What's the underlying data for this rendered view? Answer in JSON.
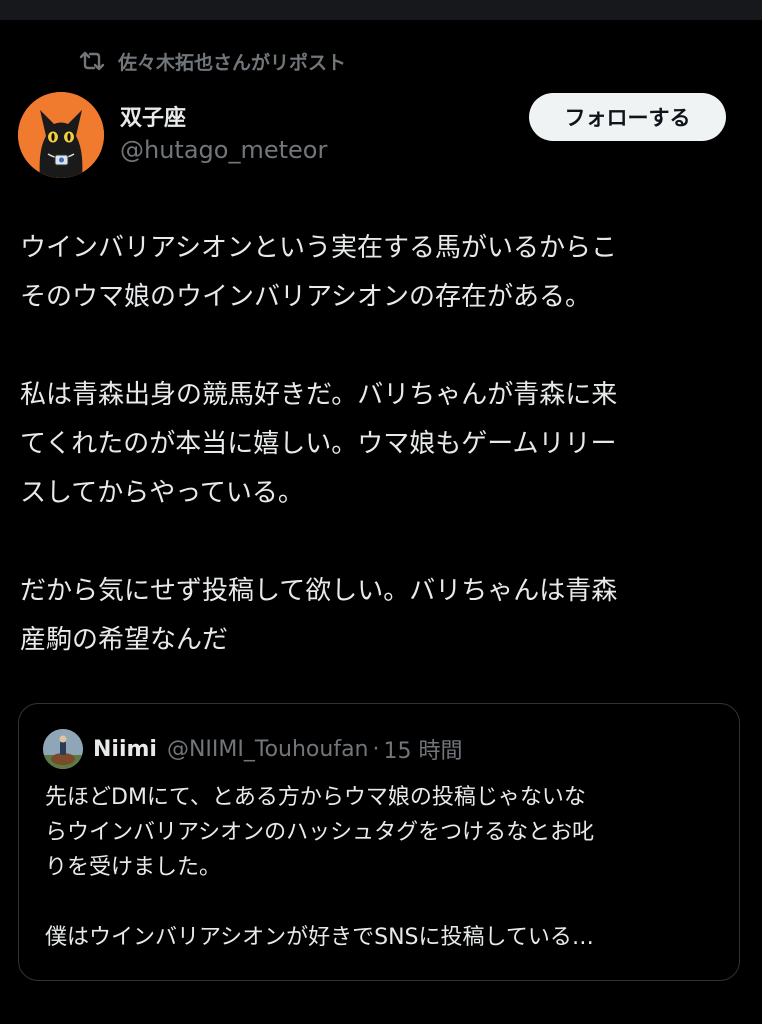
{
  "repost": {
    "icon": "repost-icon",
    "label": "佐々木拓也さんがリポスト"
  },
  "author": {
    "display_name": "双子座",
    "handle": "@hutago_meteor",
    "avatar_icon": "black-cat-avatar",
    "avatar_bg": "#f07a2e"
  },
  "follow_button": {
    "label": "フォローする"
  },
  "tweet": {
    "paragraph_1": "ウインバリアシオンという実在する馬がいるからこ\nそのウマ娘のウインバリアシオンの存在がある。",
    "paragraph_2": "私は青森出身の競馬好きだ。バリちゃんが青森に来\nてくれたのが本当に嬉しい。ウマ娘もゲームリリー\nスしてからやっている。",
    "paragraph_3": "だから気にせず投稿して欲しい。バリちゃんは青森\n産駒の希望なんだ"
  },
  "quote": {
    "name": "Niimi",
    "handle": "@NIIMI_Touhoufan",
    "separator": "·",
    "time": "15 時間",
    "paragraph_1": "先ほどDMにて、とある方からウマ娘の投稿じゃないな\nらウインバリアシオンのハッシュタグをつけるなとお叱\nりを受けました。",
    "paragraph_2": "僕はウインバリアシオンが好きでSNSに投稿している…"
  },
  "colors": {
    "background": "#000000",
    "text": "#e7e9ea",
    "muted": "#71767b",
    "border": "#2f3336",
    "follow_bg": "#eff3f4"
  }
}
